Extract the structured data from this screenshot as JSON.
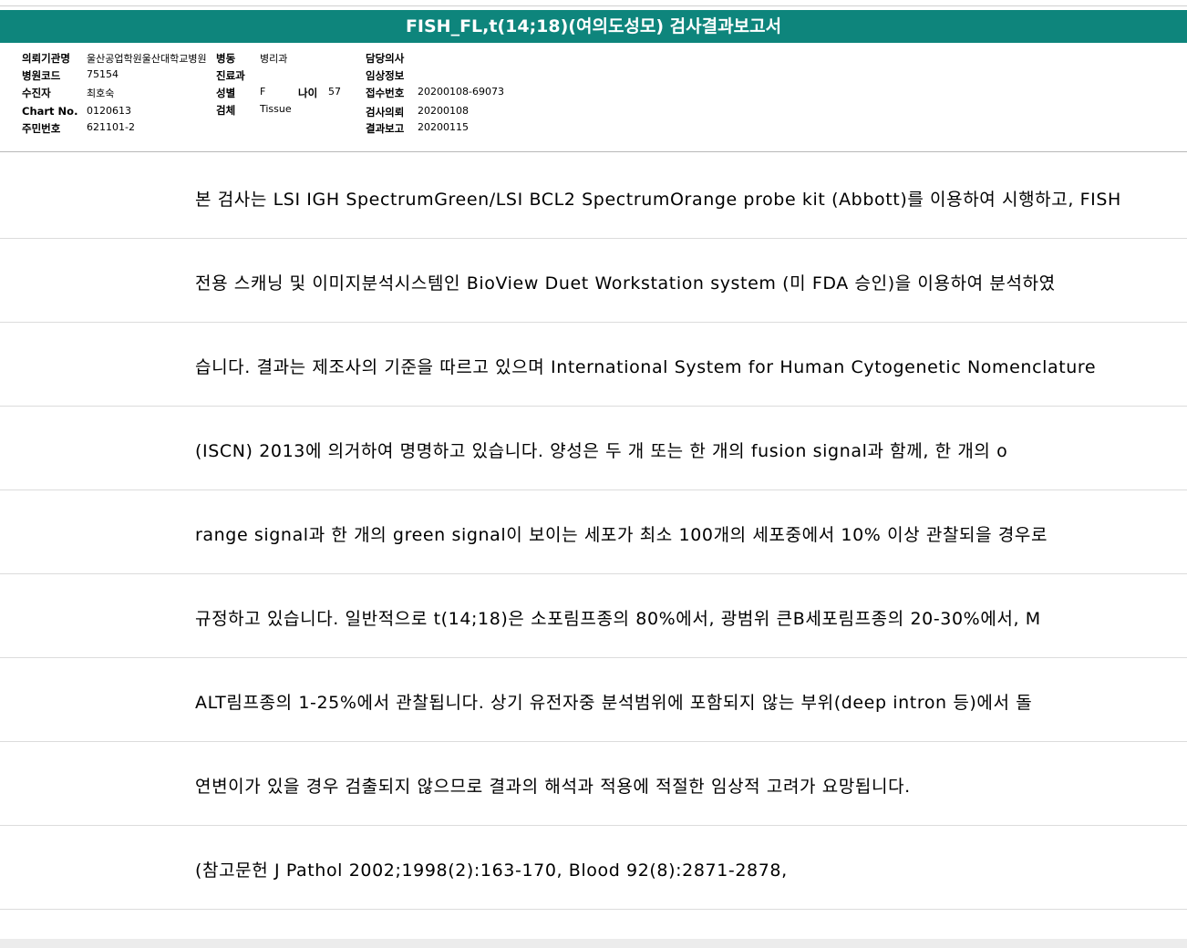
{
  "report": {
    "title": "FISH_FL,t(14;18)(여의도성모) 검사결과보고서"
  },
  "info": {
    "institution": {
      "label": "의뢰기관명",
      "value": "울산공업학원울산대학교병원"
    },
    "ward": {
      "label": "병동",
      "value": "병리과"
    },
    "doctor": {
      "label": "담당의사",
      "value": ""
    },
    "hospital_code": {
      "label": "병원코드",
      "value": "75154"
    },
    "department": {
      "label": "진료과",
      "value": ""
    },
    "clinical_info": {
      "label": "임상정보",
      "value": ""
    },
    "patient": {
      "label": "수진자",
      "value": "최호숙"
    },
    "sex": {
      "label": "성별",
      "value": "F"
    },
    "age": {
      "label": "나이",
      "value": "57"
    },
    "receipt_no": {
      "label": "접수번호",
      "value": "20200108-69073"
    },
    "chart_no": {
      "label": "Chart No.",
      "value": "0120613"
    },
    "specimen": {
      "label": "검체",
      "value": "Tissue"
    },
    "request_date": {
      "label": "검사의뢰",
      "value": "20200108"
    },
    "resident_no": {
      "label": "주민번호",
      "value": "621101-2"
    },
    "report_date": {
      "label": "결과보고",
      "value": "20200115"
    }
  },
  "lines": [
    "본 검사는 LSI IGH SpectrumGreen/LSI BCL2 SpectrumOrange probe kit (Abbott)를 이용하여 시행하고, FISH",
    "전용 스캐닝 및 이미지분석시스템인 BioView Duet Workstation system (미 FDA 승인)을 이용하여 분석하였",
    "습니다. 결과는 제조사의 기준을 따르고 있으며 International System for Human Cytogenetic Nomenclature",
    " (ISCN) 2013에 의거하여 명명하고 있습니다. 양성은 두 개 또는 한 개의 fusion signal과 함께, 한 개의 o",
    "range signal과 한 개의 green signal이 보이는 세포가 최소 100개의 세포중에서 10% 이상 관찰되을 경우로",
    " 규정하고 있습니다. 일반적으로 t(14;18)은 소포림프종의 80%에서, 광범위 큰B세포림프종의 20-30%에서, M",
    "ALT림프종의 1-25%에서 관찰됩니다. 상기 유전자중 분석범위에 포함되지 않는 부위(deep intron 등)에서 돌",
    "연변이가 있을 경우 검출되지 않으므로 결과의 해석과 적용에 적절한 임상적 고려가 요망됩니다.",
    "(참고문헌 J Pathol 2002;1998(2):163-170, Blood 92(8):2871-2878,"
  ],
  "colors": {
    "title_bar": "#0e857c"
  }
}
